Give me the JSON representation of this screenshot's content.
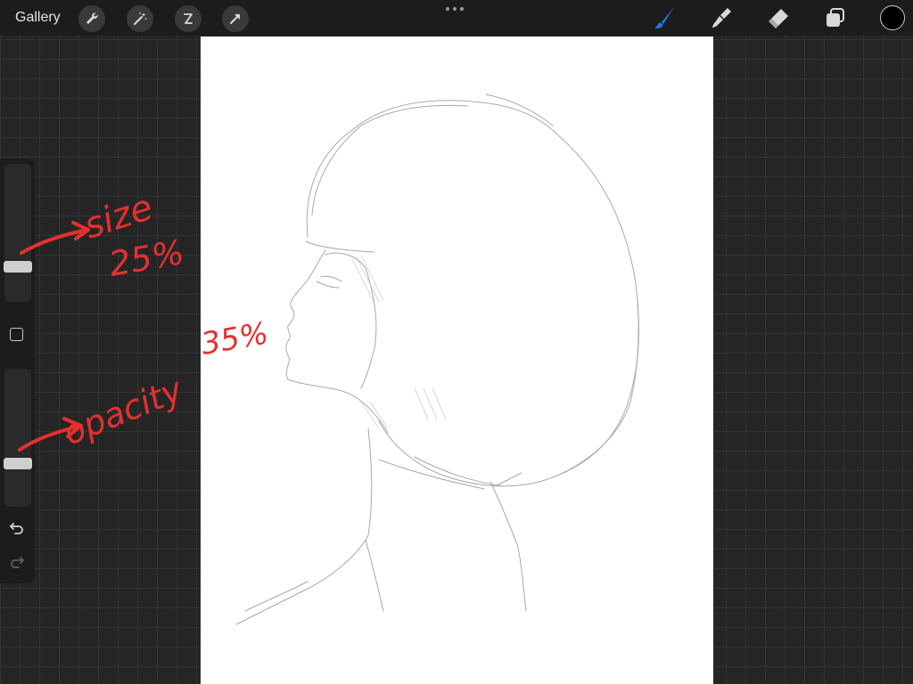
{
  "topbar": {
    "gallery_label": "Gallery",
    "left_tools": [
      "wrench-icon",
      "magic-wand-icon",
      "selection-icon",
      "transform-arrow-icon"
    ],
    "right_tools": [
      "brush-icon",
      "smudge-icon",
      "eraser-icon",
      "layers-icon"
    ],
    "active_tool": "brush-icon",
    "accent_color": "#1e7ce8",
    "current_color": "#000000"
  },
  "sidebar": {
    "size_slider_value": 0.25,
    "opacity_slider_value": 0.35,
    "modify_button": "square-icon",
    "undo": "undo-icon",
    "redo": "redo-icon"
  },
  "annotations": {
    "size_label": "size",
    "size_value": "25%",
    "opacity_label": "opacity",
    "opacity_value": "35%",
    "annotation_color": "#e53030"
  }
}
